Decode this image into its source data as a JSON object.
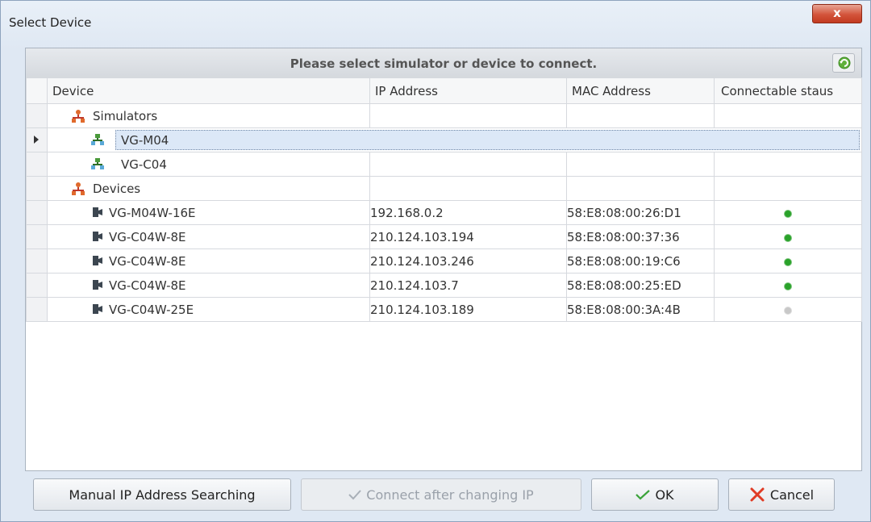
{
  "window": {
    "title": "Select Device",
    "close_label": "x"
  },
  "header": {
    "prompt": "Please select simulator or device to connect."
  },
  "columns": {
    "device": "Device",
    "ip": "IP Address",
    "mac": "MAC Address",
    "status": "Connectable staus"
  },
  "groups": {
    "simulators": {
      "label": "Simulators",
      "items": [
        "VG-M04",
        "VG-C04"
      ],
      "selected": "VG-M04"
    },
    "devices": {
      "label": "Devices"
    }
  },
  "devices": [
    {
      "name": "VG-M04W-16E",
      "ip": "192.168.0.2",
      "mac": "58:E8:08:00:26:D1",
      "status": "connectable"
    },
    {
      "name": "VG-C04W-8E",
      "ip": "210.124.103.194",
      "mac": "58:E8:08:00:37:36",
      "status": "connectable"
    },
    {
      "name": "VG-C04W-8E",
      "ip": "210.124.103.246",
      "mac": "58:E8:08:00:19:C6",
      "status": "connectable"
    },
    {
      "name": "VG-C04W-8E",
      "ip": "210.124.103.7",
      "mac": "58:E8:08:00:25:ED",
      "status": "connectable"
    },
    {
      "name": "VG-C04W-25E",
      "ip": "210.124.103.189",
      "mac": "58:E8:08:00:3A:4B",
      "status": "not-connectable"
    }
  ],
  "buttons": {
    "manual_search": "Manual IP Address Searching",
    "connect_change_ip": "Connect after changing IP",
    "ok": "OK",
    "cancel": "Cancel"
  },
  "colors": {
    "status_green": "#2aa22a",
    "status_gray": "#c8c8c8",
    "selection": "#dce8f7"
  },
  "icons": {
    "group": "network-group-icon",
    "simulator": "simulator-node-icon",
    "device": "camera-device-icon",
    "refresh": "refresh-icon"
  }
}
